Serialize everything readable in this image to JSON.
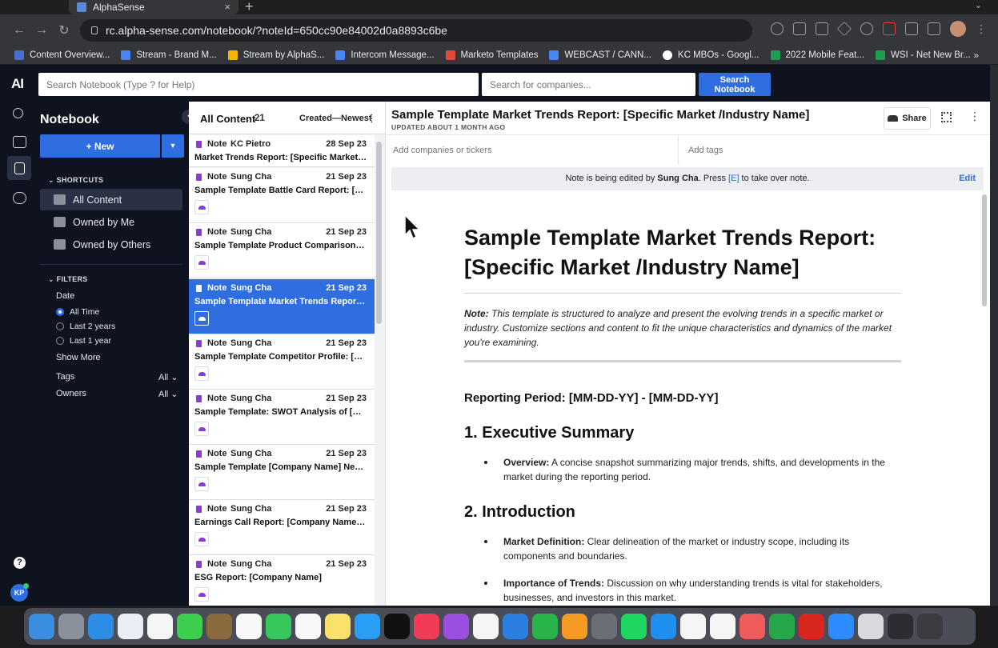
{
  "browser": {
    "tab_title": "AlphaSense",
    "url": "rc.alpha-sense.com/notebook/?noteId=650cc90e84002d0a8893c6be",
    "bookmarks": [
      "Content Overview...",
      "Stream - Brand M...",
      "Stream by AlphaS...",
      "Intercom Message...",
      "Marketo Templates",
      "WEBCAST / CANN...",
      "KC MBOs - Googl...",
      "2022 Mobile Feat...",
      "WSI - Net New Br..."
    ],
    "bookmarks_more": "»"
  },
  "app": {
    "logo": "AI",
    "search_placeholder": "Search Notebook (Type ? for Help)",
    "company_placeholder": "Search for companies...",
    "search_button": "Search Notebook",
    "user_initials": "KP",
    "help": "?"
  },
  "sidebar": {
    "title": "Notebook",
    "new_button": "+ New",
    "shortcuts_label": "SHORTCUTS",
    "shortcuts": [
      "All Content",
      "Owned by Me",
      "Owned by Others"
    ],
    "filters_label": "FILTERS",
    "date_label": "Date",
    "date_options": [
      "All Time",
      "Last 2 years",
      "Last 1 year"
    ],
    "show_more": "Show More",
    "tags_label": "Tags",
    "tags_value": "All",
    "owners_label": "Owners",
    "owners_value": "All"
  },
  "list": {
    "title": "All Content",
    "count": "21",
    "sort": "Created—Newest",
    "items": [
      {
        "type": "Note",
        "author": "KC Pietro",
        "date": "28 Sep 23",
        "title": "Market Trends Report: [Specific Market /Ind..."
      },
      {
        "type": "Note",
        "author": "Sung Cha",
        "date": "21 Sep 23",
        "title": "Sample Template Battle Card Report: [Your ..."
      },
      {
        "type": "Note",
        "author": "Sung Cha",
        "date": "21 Sep 23",
        "title": "Sample Template Product Comparison: [Yo..."
      },
      {
        "type": "Note",
        "author": "Sung Cha",
        "date": "21 Sep 23",
        "title": "Sample Template Market Trends Report: [Sp..."
      },
      {
        "type": "Note",
        "author": "Sung Cha",
        "date": "21 Sep 23",
        "title": "Sample Template Competitor Profile: [Comp..."
      },
      {
        "type": "Note",
        "author": "Sung Cha",
        "date": "21 Sep 23",
        "title": "Sample Template: SWOT Analysis of [Comp..."
      },
      {
        "type": "Note",
        "author": "Sung Cha",
        "date": "21 Sep 23",
        "title": "Sample Template [Company Name] Newslet..."
      },
      {
        "type": "Note",
        "author": "Sung Cha",
        "date": "21 Sep 23",
        "title": "Earnings Call Report: [Company Name, Tick..."
      },
      {
        "type": "Note",
        "author": "Sung Cha",
        "date": "21 Sep 23",
        "title": "ESG Report: [Company Name]"
      }
    ]
  },
  "doc": {
    "title": "Sample Template Market Trends Report: [Specific Market /Industry Name]",
    "updated": "UPDATED ABOUT 1 MONTH AGO",
    "share": "Share",
    "tickers_placeholder": "Add companies or tickers",
    "tags_placeholder": "Add tags",
    "banner_pre": "Note is being edited by ",
    "banner_user": "Sung Cha",
    "banner_mid": ". Press ",
    "banner_key": "[E]",
    "banner_post": " to take over note.",
    "edit": "Edit",
    "heading": "Sample Template Market Trends Report: [Specific Market /Industry Name]",
    "note_label": "Note:",
    "note_text": " This template is structured to analyze and present the evolving trends in a specific market or industry. Customize sections and content to fit the unique characteristics and dynamics of the market you're examining.",
    "period": "Reporting Period: [MM-DD-YY] - [MM-DD-YY]",
    "s1": "1. Executive Summary",
    "s1_b1_label": "Overview:",
    "s1_b1_text": " A concise snapshot summarizing major trends, shifts, and developments in the market during the reporting period.",
    "s2": "2. Introduction",
    "s2_b1_label": "Market Definition:",
    "s2_b1_text": " Clear delineation of the market or industry scope, including its components and boundaries.",
    "s2_b2_label": "Importance of Trends:",
    "s2_b2_text": " Discussion on why understanding trends is vital for stakeholders, businesses, and investors in this market."
  },
  "colors": {
    "accent": "#2f6ee0",
    "sidebar": "#0f1320",
    "note_icon": "#8a3bd1"
  }
}
